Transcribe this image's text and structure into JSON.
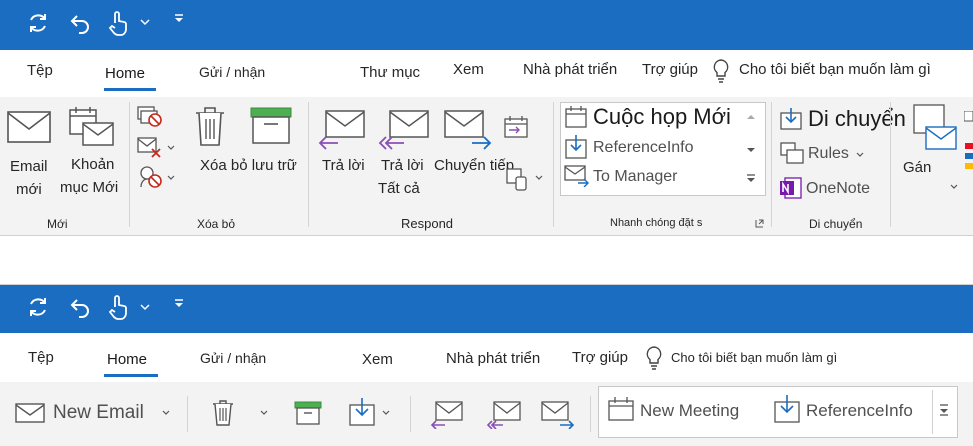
{
  "colors": {
    "accent": "#1a6dc1",
    "ribbon_bg": "#f3f3f3",
    "purple": "#7719aa",
    "red": "#c42b1c",
    "green": "#4caf50"
  },
  "top": {
    "tabs": [
      "Tệp",
      "Home",
      "Gửi / nhận",
      "Thư mục",
      "Xem",
      "Nhà phát triển",
      "Trợ giúp"
    ],
    "tell_me": "Cho tôi biết bạn muốn làm gì",
    "buttons": {
      "new_email": [
        "Email",
        "mới"
      ],
      "new_items": [
        "Khoản",
        "mục Mới"
      ],
      "archive": "Xóa bỏ lưu trữ",
      "reply": "Trả lời",
      "reply_all": [
        "Trả lời",
        "Tất cả"
      ],
      "forward": "Chuyển tiếp",
      "move": "Di chuyển",
      "rules": "Rules",
      "onenote": "OneNote",
      "assign": "Gán"
    },
    "quick_steps": [
      "Cuộc họp Mới",
      "ReferenceInfo",
      "To Manager"
    ],
    "groups": {
      "new": "Mới",
      "delete": "Xóa bỏ",
      "respond": "Respond",
      "quick_steps": "Nhanh chóng đặt s",
      "move": "Di chuyển"
    }
  },
  "bottom": {
    "tabs": [
      "Tệp",
      "Home",
      "Gửi / nhận",
      "Xem",
      "Nhà phát triển",
      "Trợ giúp"
    ],
    "tell_me": "Cho tôi biết bạn muốn làm gì",
    "new_email": "New Email",
    "quick_steps": [
      "New Meeting",
      "ReferenceInfo"
    ]
  }
}
